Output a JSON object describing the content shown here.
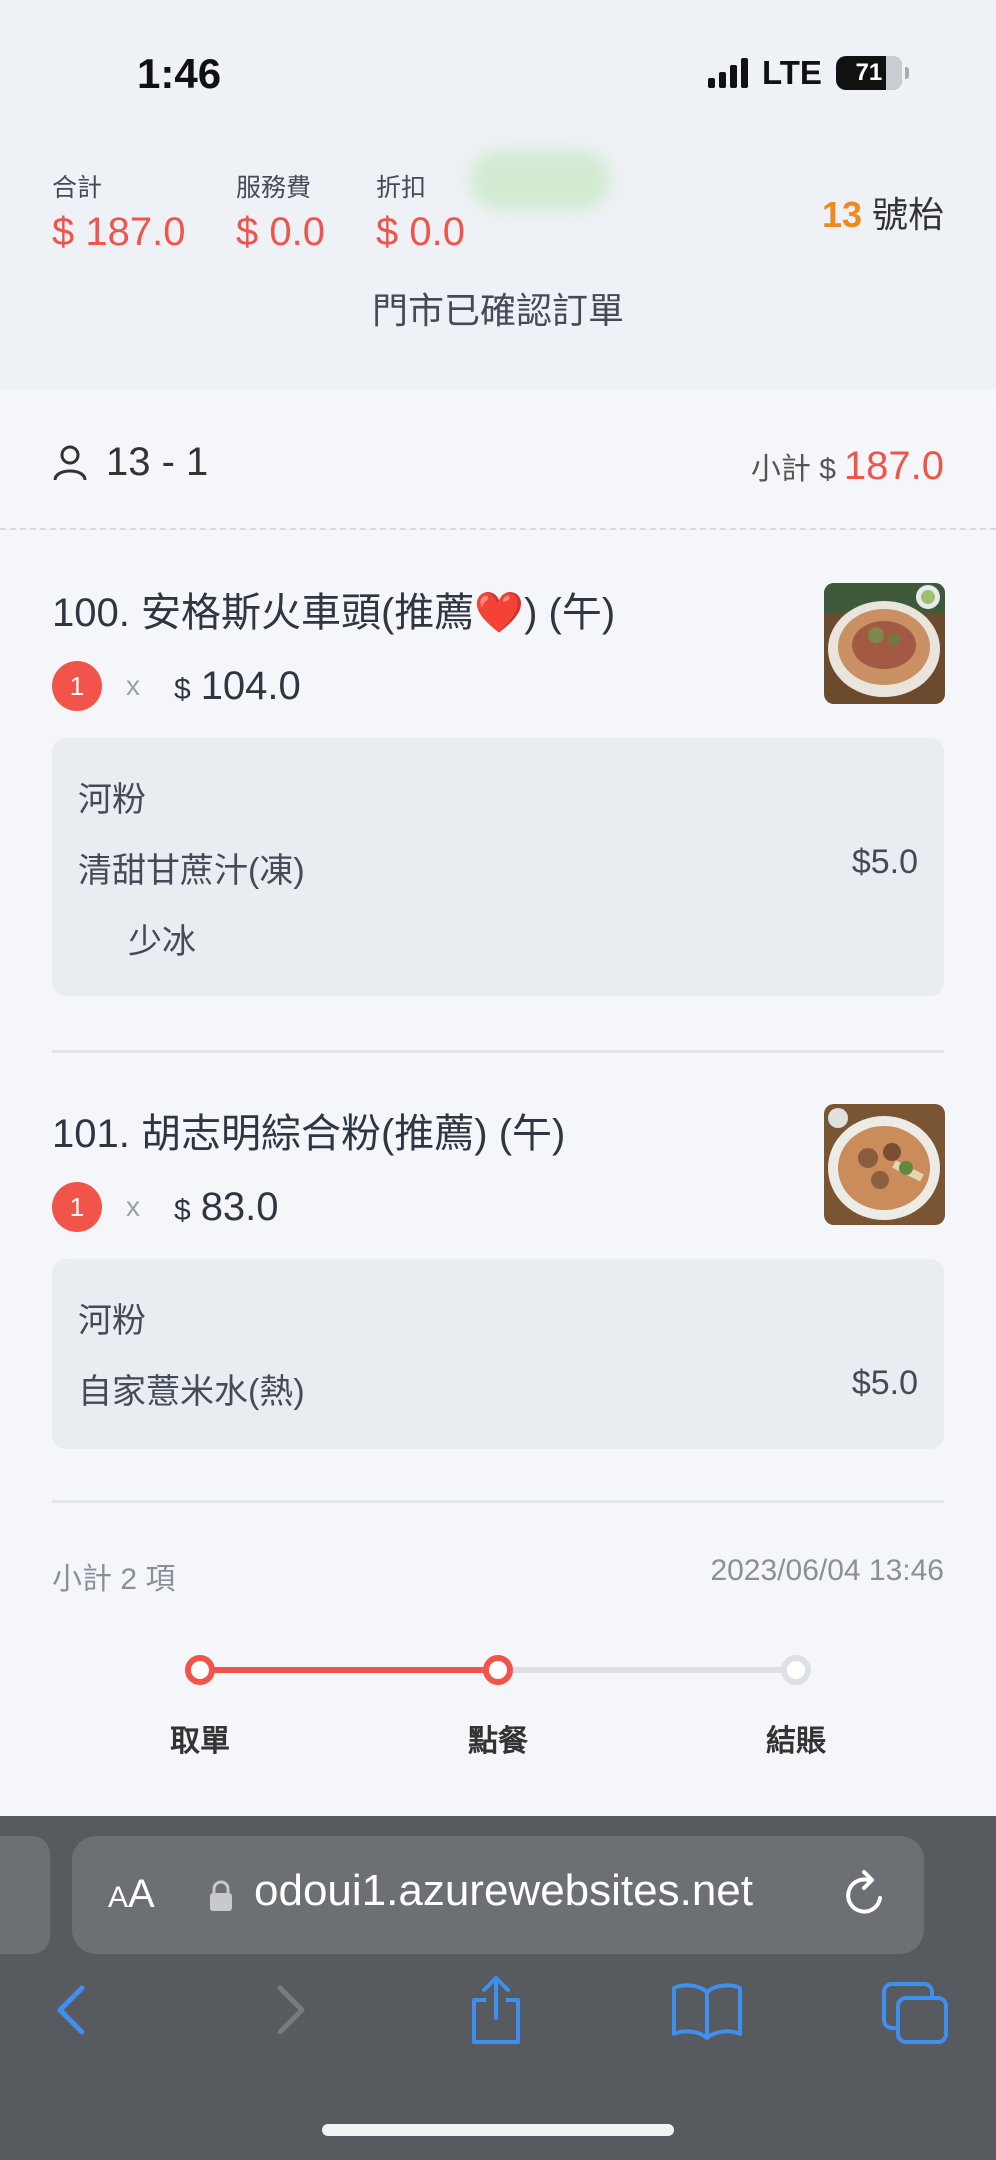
{
  "status_bar": {
    "time": "1:46",
    "network": "LTE",
    "battery": "71"
  },
  "summary": {
    "total_label": "合計",
    "total_value": "$ 187.0",
    "service_label": "服務費",
    "service_value": "$ 0.0",
    "discount_label": "折扣",
    "discount_value": "$ 0.0",
    "table_number": "13",
    "table_suffix": "號枱",
    "order_status": "門市已確認訂單"
  },
  "order": {
    "person": "13 - 1",
    "subtotal_label": "小計 $",
    "subtotal_value": "187.0",
    "items": [
      {
        "title": "100. 安格斯火車頭(推薦❤️) (午)",
        "qty": "1",
        "times": "x",
        "currency": "$",
        "price": "104.0",
        "thumb": "beef-noodle-photo",
        "options": [
          {
            "name": "河粉",
            "price": ""
          },
          {
            "name": "清甜甘蔗汁(凍)",
            "price": "$5.0"
          },
          {
            "name": "少冰",
            "price": "",
            "sub": true
          }
        ]
      },
      {
        "title": "101. 胡志明綜合粉(推薦) (午)",
        "qty": "1",
        "times": "x",
        "currency": "$",
        "price": "83.0",
        "thumb": "combo-noodle-photo",
        "options": [
          {
            "name": "河粉",
            "price": ""
          },
          {
            "name": "自家薏米水(熱)",
            "price": "$5.0"
          }
        ]
      }
    ],
    "count_label": "小計 2 項",
    "datetime": "2023/06/04 13:46"
  },
  "progress": {
    "steps": [
      "取單",
      "點餐",
      "結賬"
    ],
    "current_step": 2
  },
  "browser": {
    "aa_large": "A",
    "aa_small": "A",
    "url": "odoui1.azurewebsites.net"
  },
  "colors": {
    "accent": "#f0544a",
    "table_number": "#ef8a1f",
    "link_blue": "#3f8ff0"
  }
}
